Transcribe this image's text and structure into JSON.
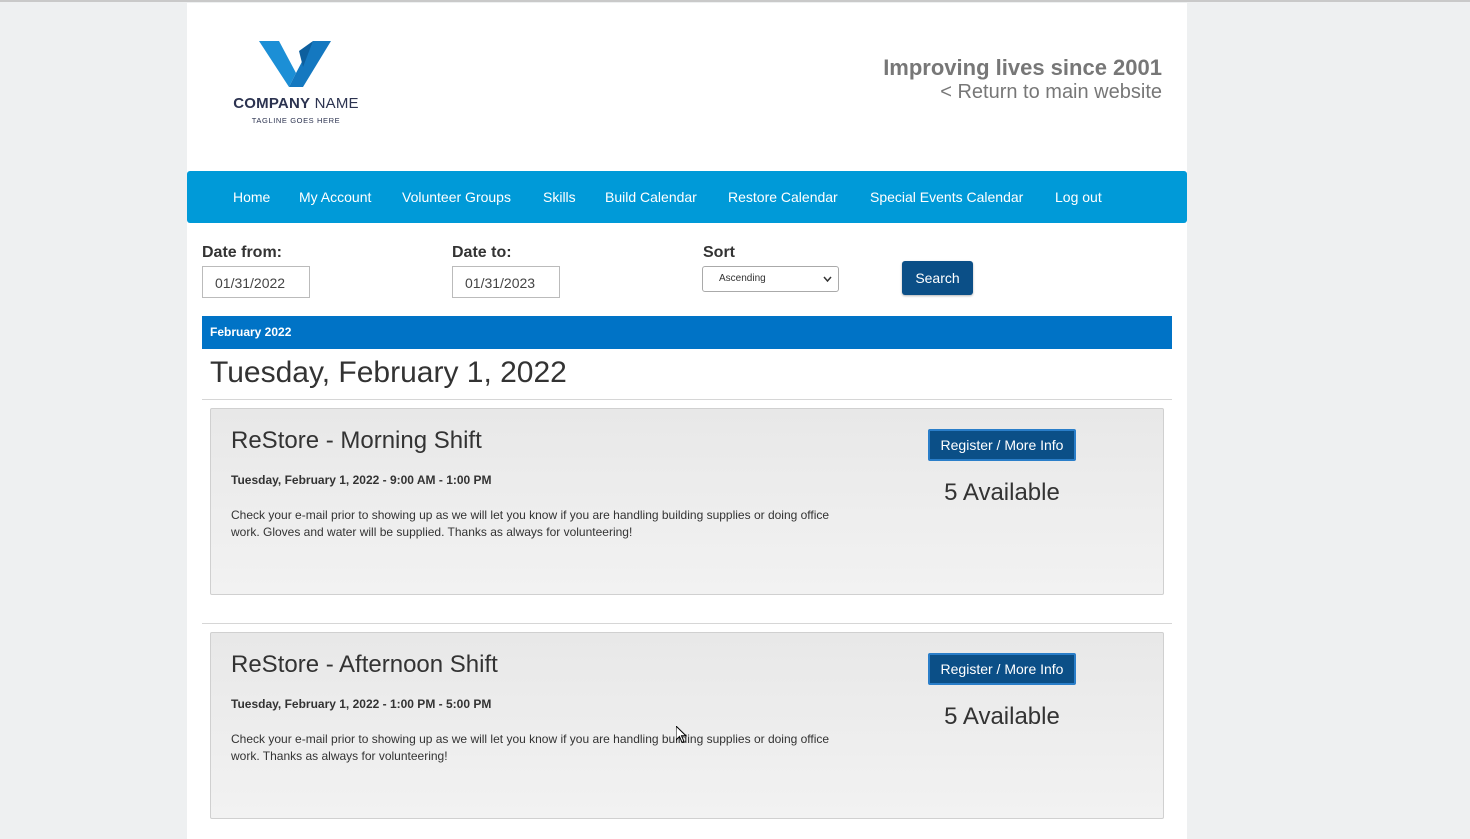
{
  "header": {
    "logo": {
      "name_bold": "COMPANY",
      "name_rest": " NAME",
      "tagline": "TAGLINE GOES HERE",
      "color": "#1c8fd6"
    },
    "tagline": "Improving lives since 2001",
    "return_link": "< Return to main website"
  },
  "nav": {
    "color": "#009ad8",
    "items": [
      "Home",
      "My Account",
      "Volunteer Groups",
      "Skills",
      "Build Calendar",
      "Restore Calendar",
      "Special Events Calendar",
      "Log out"
    ]
  },
  "filters": {
    "date_from_label": "Date from:",
    "date_from_value": "01/31/2022",
    "date_to_label": "Date to:",
    "date_to_value": "01/31/2023",
    "sort_label": "Sort",
    "sort_value": "Ascending",
    "search_label": "Search"
  },
  "month": {
    "label": "February 2022",
    "color": "#0073c6"
  },
  "day": {
    "heading": "Tuesday, February 1, 2022"
  },
  "events": [
    {
      "title": "ReStore - Morning Shift",
      "time": "Tuesday, February 1, 2022 - 9:00 AM - 1:00 PM",
      "description": "Check your e-mail prior to showing up as we will let you know if you are handling building supplies or doing office work. Gloves and water will be supplied. Thanks as always for volunteering!",
      "button": "Register / More Info",
      "available": "5 Available"
    },
    {
      "title": "ReStore - Afternoon Shift",
      "time": "Tuesday, February 1, 2022 - 1:00 PM - 5:00 PM",
      "description": "Check your e-mail prior to showing up as we will let you know if you are handling building supplies or doing office work. Thanks as always for volunteering!",
      "button": "Register / More Info",
      "available": "5 Available"
    }
  ]
}
